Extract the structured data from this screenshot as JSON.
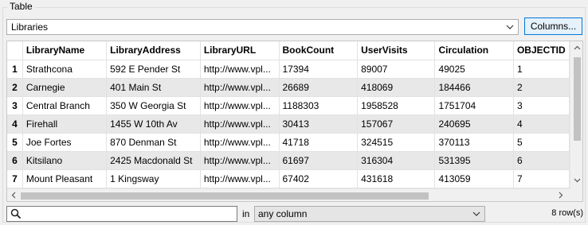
{
  "group": {
    "title": "Table"
  },
  "layer_select": {
    "value": "Libraries"
  },
  "columns_button": {
    "label": "Columns..."
  },
  "table": {
    "columns": [
      "LibraryName",
      "LibraryAddress",
      "LibraryURL",
      "BookCount",
      "UserVisits",
      "Circulation",
      "OBJECTID"
    ],
    "rows": [
      {
        "num": "1",
        "cells": [
          "Strathcona",
          "592 E Pender St",
          "http://www.vpl...",
          "17394",
          "89007",
          "49025",
          "1"
        ]
      },
      {
        "num": "2",
        "cells": [
          "Carnegie",
          "401 Main St",
          "http://www.vpl...",
          "26689",
          "418069",
          "184466",
          "2"
        ]
      },
      {
        "num": "3",
        "cells": [
          "Central Branch",
          "350 W Georgia St",
          "http://www.vpl...",
          "1188303",
          "1958528",
          "1751704",
          "3"
        ]
      },
      {
        "num": "4",
        "cells": [
          "Firehall",
          "1455 W 10th Av",
          "http://www.vpl...",
          "30413",
          "157067",
          "240695",
          "4"
        ]
      },
      {
        "num": "5",
        "cells": [
          "Joe Fortes",
          "870 Denman St",
          "http://www.vpl...",
          "41718",
          "324515",
          "370113",
          "5"
        ]
      },
      {
        "num": "6",
        "cells": [
          "Kitsilano",
          "2425 Macdonald St",
          "http://www.vpl...",
          "61697",
          "316304",
          "531395",
          "6"
        ]
      },
      {
        "num": "7",
        "cells": [
          "Mount Pleasant",
          "1 Kingsway",
          "http://www.vpl...",
          "67402",
          "431618",
          "413059",
          "7"
        ]
      }
    ]
  },
  "search": {
    "value": "",
    "icon": "search-icon"
  },
  "filter": {
    "in_label": "in",
    "column_value": "any column"
  },
  "status": {
    "row_count": "8 row(s)"
  }
}
